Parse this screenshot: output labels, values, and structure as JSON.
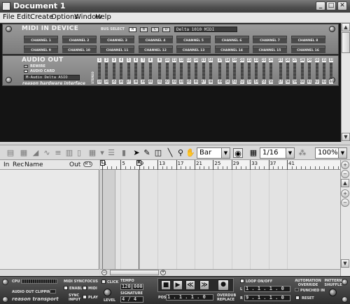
{
  "window": {
    "title": "Document 1",
    "minimize": "_",
    "maximize": "□",
    "close": "✕"
  },
  "menu": [
    "File",
    "Edit",
    "Create",
    "Options",
    "Window",
    "Help"
  ],
  "midi_in": {
    "title": "MIDI IN DEVICE",
    "bus_select_label": "BUS SELECT",
    "bus_buttons": [
      "A",
      "B",
      "C",
      "D"
    ],
    "display": "Delta 1010 MIDI",
    "channels": [
      "CHANNEL 1",
      "CHANNEL 2",
      "CHANNEL 3",
      "CHANNEL 4",
      "CHANNEL 5",
      "CHANNEL 6",
      "CHANNEL 7",
      "CHANNEL 8",
      "CHANNEL 9",
      "CHANNEL 10",
      "CHANNEL 11",
      "CHANNEL 12",
      "CHANNEL 13",
      "CHANNEL 14",
      "CHANNEL 15",
      "CHANNEL 16"
    ]
  },
  "audio_out": {
    "title": "AUDIO OUT",
    "rewire_label": "REWIRE",
    "audio_card_label": "AUDIO CARD",
    "device_display": "M-Audio Delta ASIO",
    "stereo_label": "STEREO",
    "meters_top": [
      "1",
      "2",
      "3",
      "4",
      "5",
      "6",
      "7",
      "8",
      "9",
      "10",
      "11",
      "12",
      "13",
      "14",
      "15",
      "16",
      "17",
      "18",
      "19",
      "20",
      "21",
      "22",
      "23",
      "24",
      "25",
      "26",
      "27",
      "28",
      "29",
      "30",
      "31",
      "32"
    ],
    "meters_bottom": [
      "33",
      "34",
      "35",
      "36",
      "37",
      "38",
      "39",
      "40",
      "41",
      "42",
      "43",
      "44",
      "45",
      "46",
      "47",
      "48",
      "49",
      "50",
      "51",
      "52",
      "53",
      "54",
      "55",
      "56",
      "57",
      "58",
      "59",
      "60",
      "61",
      "62",
      "63",
      "64"
    ],
    "brand": "reason hardware interface"
  },
  "seq_toolbar": {
    "snap_value": "Bar",
    "quantize_value": "1/16",
    "zoom_value": "100%"
  },
  "track_header": {
    "in": "In",
    "rec": "Rec",
    "name": "Name",
    "out": "Out",
    "ms": "M S"
  },
  "ruler": {
    "markers": [
      "1",
      "5",
      "9",
      "13",
      "17",
      "21",
      "25",
      "29",
      "33",
      "37",
      "41"
    ],
    "loop_left": "L",
    "loop_right": "R"
  },
  "transport": {
    "cpu_label": "CPU",
    "clip_label": "AUDIO OUT CLIPPING",
    "brand": "reason transport",
    "midi_sync_label": "MIDI SYNC",
    "focus_label": "FOCUS",
    "enable_label": "ENABLE",
    "midi_label": "MIDI",
    "sync_input_label": "SYNC INPUT",
    "play_label": "PLAY",
    "click_label": "CLICK",
    "level_label": "LEVEL",
    "tempo_label": "TEMPO",
    "tempo_value": "120",
    "tempo_fraction": "000",
    "signature_label": "SIGNATURE",
    "signature_value": "4 / 4",
    "pos_label": "POS",
    "pos_value": "1 . 1 . 1 . 0",
    "overdub_label": "OVERDUB REPLACE",
    "loop_label": "LOOP ON/OFF",
    "loop_l_label": "L",
    "loop_r_label": "R",
    "loop_l_value": "1 . 1 . 1 . 0",
    "loop_r_value": "9 . 1 . 1 . 0",
    "automation_label": "AUTOMATION OVERRIDE",
    "punched_in_label": "PUNCHED IN",
    "reset_label": "RESET",
    "pattern_label": "PATTERN SHUFFLE"
  }
}
